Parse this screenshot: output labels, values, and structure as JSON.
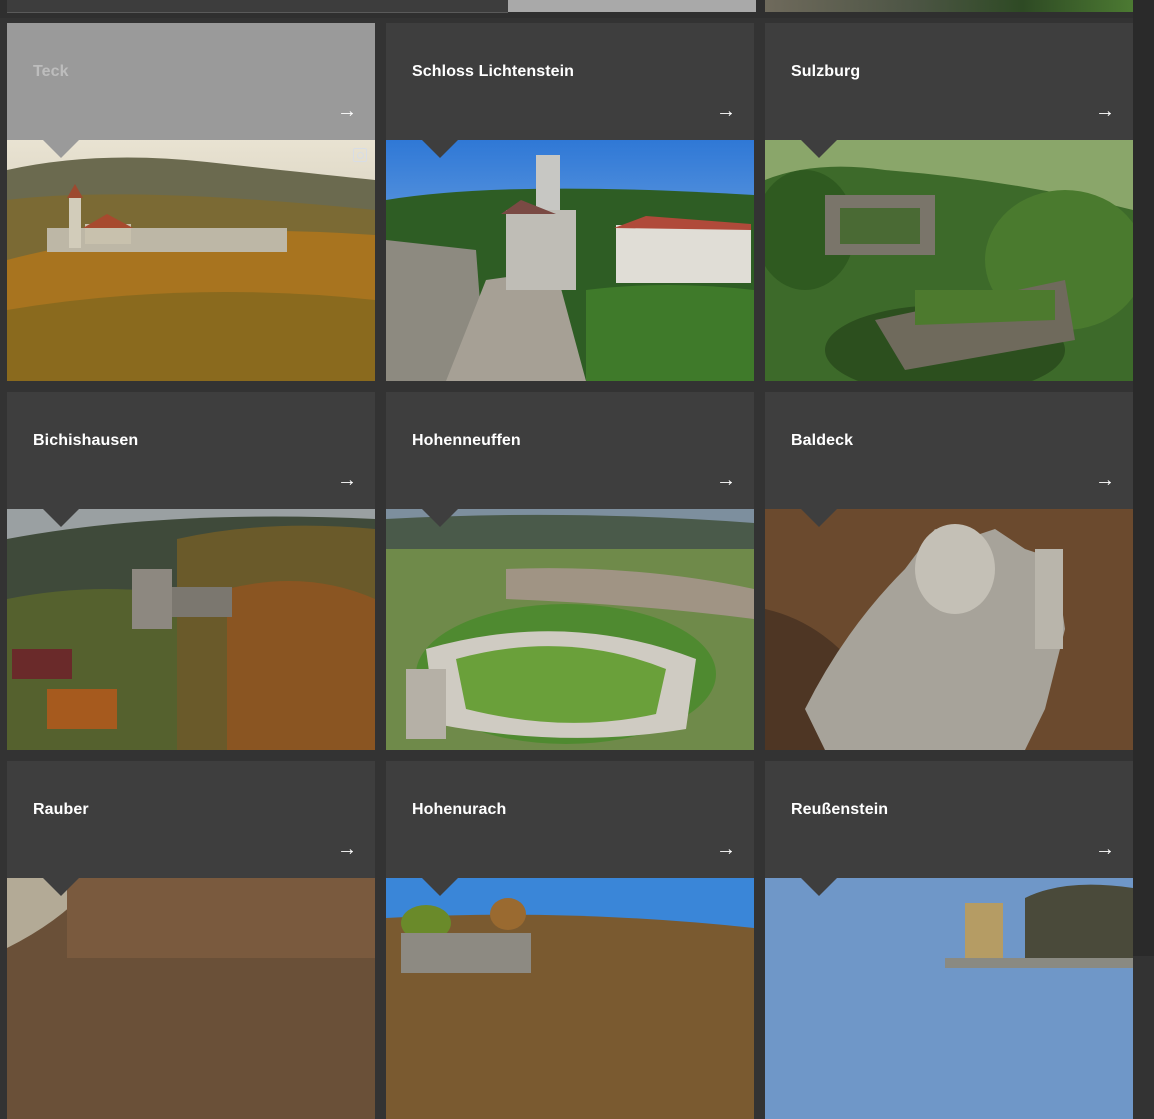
{
  "tiles": [
    {
      "title": "Teck",
      "arrow": "→"
    },
    {
      "title": "Schloss Lichtenstein",
      "arrow": "→"
    },
    {
      "title": "Sulzburg",
      "arrow": "→"
    },
    {
      "title": "Bichishausen",
      "arrow": "→"
    },
    {
      "title": "Hohenneuffen",
      "arrow": "→"
    },
    {
      "title": "Baldeck",
      "arrow": "→"
    },
    {
      "title": "Rauber",
      "arrow": "→"
    },
    {
      "title": "Hohenurach",
      "arrow": "→"
    },
    {
      "title": "Reußenstein",
      "arrow": "→"
    }
  ],
  "active_tile": "Teck",
  "colors": {
    "page_bg": "#333333",
    "tile_bg": "#3e3e3e",
    "active_tile_bg": "#9a9a9a"
  },
  "icons": {
    "arrow": "arrow-right-icon",
    "expand": "expand-icon"
  }
}
